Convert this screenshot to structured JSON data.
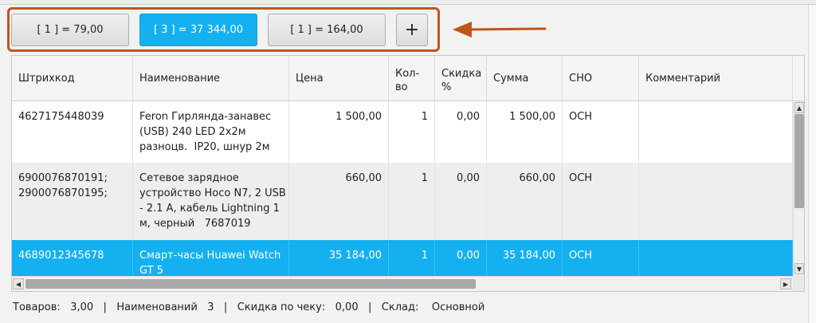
{
  "tabs": [
    {
      "label": "[ 1 ]  = 79,00",
      "active": false
    },
    {
      "label": "[ 3 ]  = 37 344,00",
      "active": true
    },
    {
      "label": "[ 1 ]  = 164,00",
      "active": false
    }
  ],
  "add_tab_label": "+",
  "colors": {
    "accent": "#14b0ef",
    "highlight": "#c0551c"
  },
  "table": {
    "columns": [
      "Штрихкод",
      "Наименование",
      "Цена",
      "Кол-\nво",
      "Скидка\n%",
      "Сумма",
      "СНО",
      "Комментарий"
    ],
    "rows": [
      {
        "barcode": "4627175448039",
        "name": "Feron Гирлянда-занавес\n(USB) 240 LED 2х2м\nразноцв.  IP20, шнур 2м",
        "price": "1 500,00",
        "qty": "1",
        "discount": "0,00",
        "sum": "1 500,00",
        "sno": "ОСН",
        "comment": ""
      },
      {
        "barcode": "6900076870191;\n2900076870195;",
        "name": "Сетевое зарядное\nустройство Hoco N7, 2 USB\n- 2.1 A, кабель Lightning 1\nм, черный   7687019",
        "price": "660,00",
        "qty": "1",
        "discount": "0,00",
        "sum": "660,00",
        "sno": "ОСН",
        "comment": ""
      },
      {
        "barcode": "4689012345678",
        "name": "Смарт-часы Huawei Watch\nGT 5",
        "price": "35 184,00",
        "qty": "1",
        "discount": "0,00",
        "sum": "35 184,00",
        "sno": "ОСН",
        "comment": ""
      }
    ],
    "selected_row": 2
  },
  "footer": {
    "goods_label": "Товаров:",
    "goods_value": "3,00",
    "names_label": "Наименований",
    "names_value": "3",
    "discount_label": "Скидка по чеку:",
    "discount_value": "0,00",
    "warehouse_label": "Склад:",
    "warehouse_value": "Основной",
    "separator": "|"
  }
}
